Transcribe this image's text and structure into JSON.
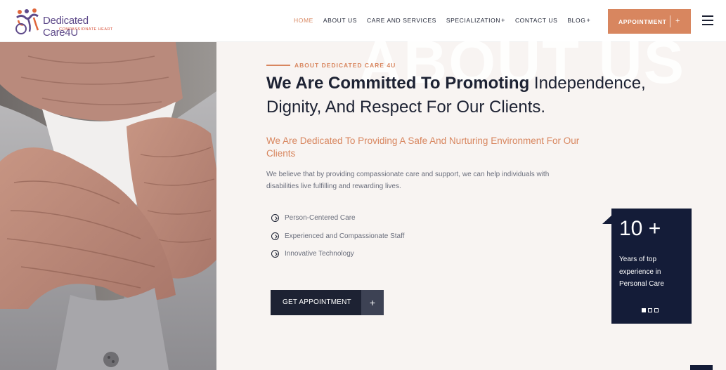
{
  "brand": {
    "name": "Dedicated Care4U",
    "tagline": "COMPASSIONATE HEART"
  },
  "nav": {
    "items": [
      {
        "label": "HOME",
        "active": true,
        "has_submenu": false
      },
      {
        "label": "ABOUT US",
        "active": false,
        "has_submenu": false
      },
      {
        "label": "CARE AND SERVICES",
        "active": false,
        "has_submenu": false
      },
      {
        "label": "SPECIALIZATION",
        "active": false,
        "has_submenu": true
      },
      {
        "label": "CONTACT US",
        "active": false,
        "has_submenu": false
      },
      {
        "label": "BLOG",
        "active": false,
        "has_submenu": true
      }
    ],
    "submenu_symbol": "+",
    "appointment_label": "APPOINTMENT",
    "appointment_plus": "+",
    "menu_icon": "hamburger-icon"
  },
  "about": {
    "watermark": "ABOUT US",
    "eyebrow": "ABOUT DEDICATED CARE 4U",
    "headline_bold": "We Are Committed To Promoting",
    "headline_rest": " Independence, Dignity, And Respect For Our Clients.",
    "subheading": "We Are Dedicated To Providing A Safe And Nurturing Environment For Our Clients",
    "paragraph": "We believe that by providing compassionate care and support, we can help individuals with disabilities live fulfilling and rewarding lives.",
    "features": [
      "Person-Centered Care",
      "Experienced and Compassionate Staff",
      "Innovative Technology"
    ],
    "feature_icon": "chevron-circle-icon",
    "cta_label": "GET APPOINTMENT",
    "cta_plus": "+"
  },
  "experience": {
    "number": "10 +",
    "description": "Years of top experience in Personal Care",
    "slide_count": 3,
    "active_slide": 0
  },
  "colors": {
    "accent": "#d8865f",
    "navy": "#141c38",
    "background": "#f8f4f2"
  }
}
